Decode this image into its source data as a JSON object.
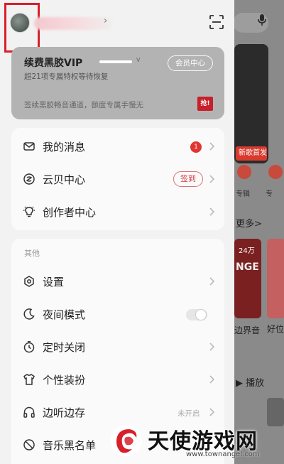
{
  "background": {
    "banner_tag": "新歌首发",
    "items": [
      "专辑",
      "专"
    ],
    "more_label": "更多>",
    "card1_badge": "24万",
    "card2_badge": "",
    "card1_title": "NGE",
    "card_labels": [
      "边界音",
      "好位"
    ],
    "play_label": "播放"
  },
  "header": {
    "scan_icon": "scan-icon"
  },
  "vip": {
    "title": "续费黑胶VIP",
    "subtitle": "超21项专属特权等待恢复",
    "center_button": "会员中心",
    "promo": "签续黑胶畅音通道，额度专属手慢无",
    "promo_badge": "抢!"
  },
  "menu1": [
    {
      "label": "我的消息",
      "badge": "1"
    },
    {
      "label": "云贝中心",
      "action": "签到"
    },
    {
      "label": "创作者中心"
    }
  ],
  "menu2": {
    "title": "其他",
    "items": [
      {
        "label": "设置"
      },
      {
        "label": "夜间模式"
      },
      {
        "label": "定时关闭"
      },
      {
        "label": "个性装扮"
      },
      {
        "label": "边听边存",
        "status": "未开启"
      },
      {
        "label": "音乐黑名单"
      }
    ]
  },
  "watermark": {
    "text": "天使游戏网",
    "url": "www.townangel.com"
  },
  "colors": {
    "accent": "#d8202a",
    "vip_card": "#b3b3b3",
    "drawer_bg": "#f2f2f2"
  }
}
